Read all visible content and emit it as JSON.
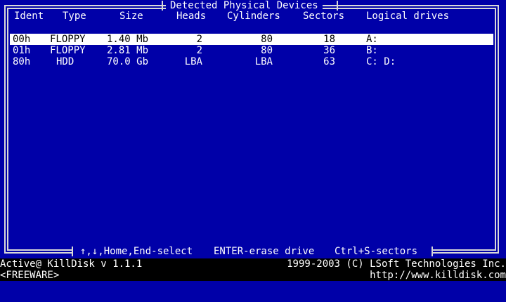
{
  "window": {
    "title": "Detected Physical Devices"
  },
  "columns": {
    "ident": "Ident",
    "type": "Type",
    "size": "Size",
    "heads": "Heads",
    "cylinders": "Cylinders",
    "sectors": "Sectors",
    "logical_drives": "Logical drives"
  },
  "devices": [
    {
      "ident": "00h",
      "type": "FLOPPY",
      "size": "1.40 Mb",
      "heads": "2",
      "cylinders": "80",
      "sectors": "18",
      "logical_drives": "A:",
      "selected": true
    },
    {
      "ident": "01h",
      "type": "FLOPPY",
      "size": "2.81 Mb",
      "heads": "2",
      "cylinders": "80",
      "sectors": "36",
      "logical_drives": "B:",
      "selected": false
    },
    {
      "ident": "80h",
      "type": "HDD",
      "size": "70.0 Gb",
      "heads": "LBA",
      "cylinders": "LBA",
      "sectors": "63",
      "logical_drives": "C: D:",
      "selected": false
    }
  ],
  "help": {
    "navigate": "↑,↓,Home,End-select",
    "erase": "ENTER-erase drive",
    "sectors": "Ctrl+S-sectors"
  },
  "status": {
    "product": "Active@ KillDisk v 1.1.1",
    "copyright": "1999-2003 (C) LSoft Technologies Inc.",
    "license": "<FREEWARE>",
    "url": "http://www.killdisk.com"
  },
  "colors": {
    "background": "#0000a8",
    "frame": "#d8d8d8",
    "selection": "#ffffff",
    "status_bar": "#000000"
  }
}
